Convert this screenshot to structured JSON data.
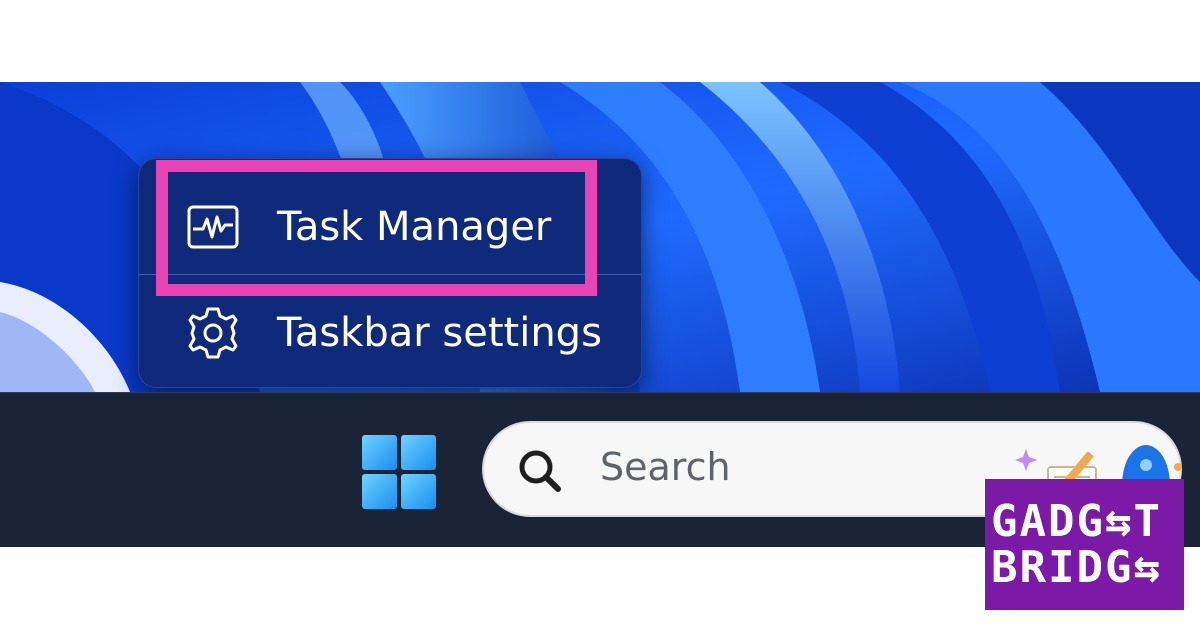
{
  "context_menu": {
    "items": [
      {
        "label": "Task Manager",
        "icon": "task-manager-icon",
        "highlighted": true
      },
      {
        "label": "Taskbar settings",
        "icon": "gear-icon",
        "highlighted": false
      }
    ]
  },
  "taskbar": {
    "start_icon": "windows-start-icon",
    "search": {
      "placeholder": "Search",
      "icon": "search-icon"
    }
  },
  "watermark": {
    "line1": "GADG⇆T",
    "line2": "BRIDG⇆"
  },
  "colors": {
    "highlight": "#e944b5",
    "menu_bg": "#0f2a7a",
    "taskbar_bg": "#1b2337",
    "watermark_bg": "#7a1aa6",
    "wallpaper": "#1a5cff"
  }
}
